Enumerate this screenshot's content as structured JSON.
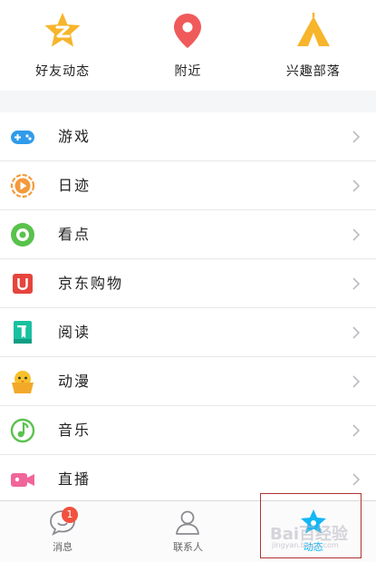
{
  "top_shortcuts": [
    {
      "label": "好友动态",
      "icon": "star-z-icon",
      "color": "#f7b52c"
    },
    {
      "label": "附近",
      "icon": "location-pin-icon",
      "color": "#f05a5a"
    },
    {
      "label": "兴趣部落",
      "icon": "tent-icon",
      "color": "#f7b52c"
    }
  ],
  "menu": [
    {
      "label": "游戏",
      "icon": "gamepad-icon",
      "color": "#2f9bea"
    },
    {
      "label": "日迹",
      "icon": "play-circle-icon",
      "color": "#f39a3b"
    },
    {
      "label": "看点",
      "icon": "eye-icon",
      "color": "#59c24c"
    },
    {
      "label": "京东购物",
      "icon": "jd-bag-icon",
      "color": "#e5453d"
    },
    {
      "label": "阅读",
      "icon": "book-icon",
      "color": "#19c1a0"
    },
    {
      "label": "动漫",
      "icon": "chick-icon",
      "color": "#f7c12a"
    },
    {
      "label": "音乐",
      "icon": "music-note-icon",
      "color": "#5bc24f"
    },
    {
      "label": "直播",
      "icon": "video-camera-icon",
      "color": "#f0669a"
    }
  ],
  "tabbar": {
    "messages": {
      "label": "消息",
      "badge": "1"
    },
    "contacts": {
      "label": "联系人"
    },
    "feed": {
      "label": "动态"
    }
  },
  "watermark": {
    "text": "Bai百经验",
    "sub": "jingyan.baidu.com"
  },
  "colors": {
    "accent": "#12b7f5",
    "badge": "#f1513e",
    "highlight": "#b23333"
  }
}
